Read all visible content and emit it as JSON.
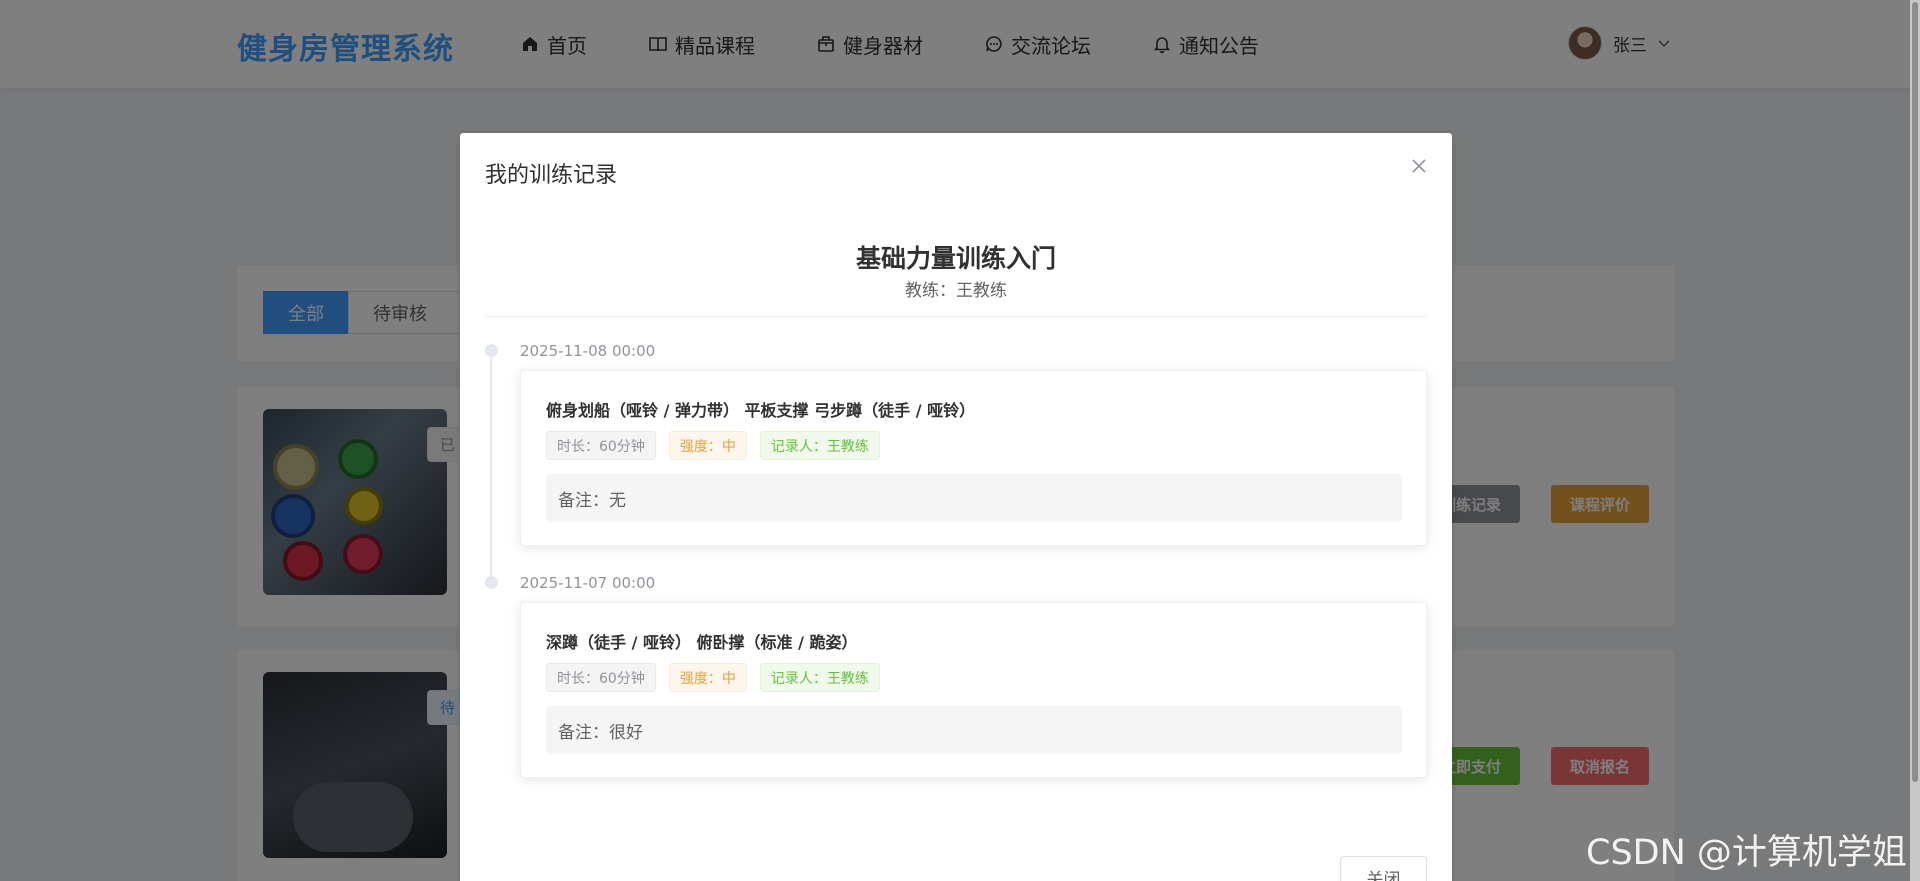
{
  "app": {
    "logo": "健身房管理系统",
    "nav": [
      {
        "label": "首页",
        "icon": "home-icon"
      },
      {
        "label": "精品课程",
        "icon": "book-icon"
      },
      {
        "label": "健身器材",
        "icon": "box-icon"
      },
      {
        "label": "交流论坛",
        "icon": "chat-icon"
      },
      {
        "label": "通知公告",
        "icon": "bell-icon"
      }
    ],
    "user": {
      "name": "张三"
    }
  },
  "filters": {
    "tabs": [
      "全部",
      "待审核"
    ],
    "active": "全部"
  },
  "courses": [
    {
      "status": "已",
      "actions": [
        "训练记录",
        "课程评价"
      ]
    },
    {
      "status": "待",
      "actions": [
        "立即支付",
        "取消报名"
      ]
    }
  ],
  "dialog": {
    "title": "我的训练记录",
    "course_title": "基础力量训练入门",
    "coach_label": "教练：王教练",
    "records": [
      {
        "time": "2025-11-08 00:00",
        "exercises": "俯身划船（哑铃 / 弹力带） 平板支撑 弓步蹲（徒手 / 哑铃）",
        "duration": "时长：60分钟",
        "intensity": "强度：中",
        "recorder": "记录人：王教练",
        "note": "备注：无"
      },
      {
        "time": "2025-11-07 00:00",
        "exercises": "深蹲（徒手 / 哑铃） 俯卧撑（标准 / 跪姿）",
        "duration": "时长：60分钟",
        "intensity": "强度：中",
        "recorder": "记录人：王教练",
        "note": "备注：很好"
      }
    ],
    "close_button": "关闭"
  },
  "watermark": "CSDN @计算机学姐",
  "colors": {
    "primary": "#409eff",
    "warning": "#e6a23c",
    "success": "#67c23a",
    "danger": "#f56c6c",
    "info": "#909399"
  }
}
